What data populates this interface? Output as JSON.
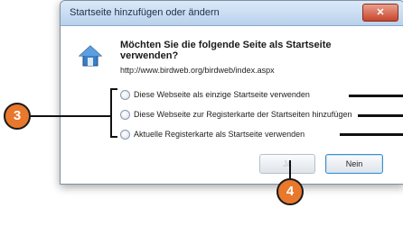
{
  "dialog": {
    "title": "Startseite hinzufügen oder ändern",
    "close_label": "✕",
    "question": "Möchten Sie die folgende Seite als Startseite verwenden?",
    "url": "http://www.birdweb.org/birdweb/index.aspx",
    "options": [
      "Diese Webseite als einzige Startseite verwenden",
      "Diese Webseite zur Registerkarte der Startseiten hinzufügen",
      "Aktuelle Registerkarte als Startseite verwenden"
    ],
    "yes_label": "Ja",
    "no_label": "Nein"
  },
  "callouts": {
    "options_number": "3",
    "yes_number": "4"
  },
  "colors": {
    "callout": "#e8782b",
    "titlebar": "#c6daf1",
    "close": "#c8452d"
  },
  "icons": {
    "dialog_icon": "home-icon"
  }
}
